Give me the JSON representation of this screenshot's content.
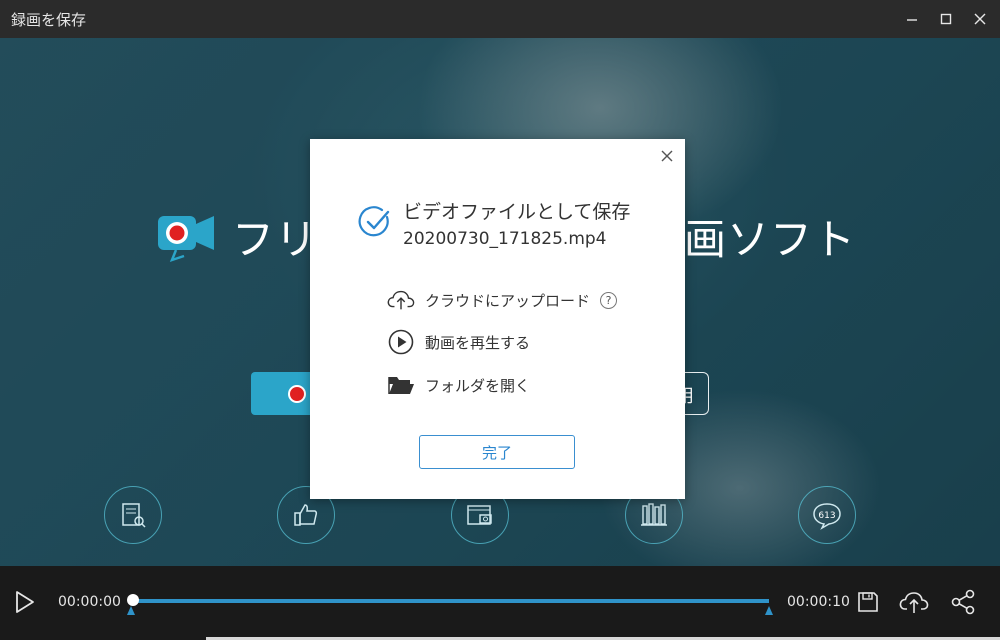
{
  "window": {
    "title": "録画を保存",
    "controls": [
      "minimize-icon",
      "maximize-icon",
      "close-icon"
    ]
  },
  "background": {
    "hero_text_left": "フリ",
    "hero_text_right": "画ソフト",
    "button_right_text": "用",
    "circle_badge": "613"
  },
  "dialog": {
    "title": "ビデオファイルとして保存",
    "filename": "20200730_171825.mp4",
    "actions": [
      {
        "label": "クラウドにアップロード",
        "icon": "cloud-upload-icon"
      },
      {
        "label": "動画を再生する",
        "icon": "play-circle-icon"
      },
      {
        "label": "フォルダを開く",
        "icon": "folder-icon"
      }
    ],
    "help": "?",
    "done_label": "完了",
    "accent": "#2a86cf"
  },
  "player": {
    "current_time": "00:00:00",
    "end_time": "00:00:10",
    "progress": 0.0,
    "accent": "#2f93c9"
  }
}
